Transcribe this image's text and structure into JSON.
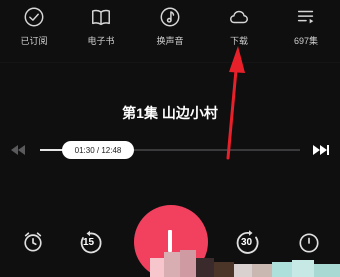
{
  "top_actions": [
    {
      "label": "已订阅",
      "icon": "check-circle-icon"
    },
    {
      "label": "电子书",
      "icon": "book-icon"
    },
    {
      "label": "换声音",
      "icon": "voice-icon"
    },
    {
      "label": "下载",
      "icon": "cloud-download-icon"
    },
    {
      "label": "697集",
      "icon": "playlist-icon"
    }
  ],
  "episode": {
    "title": "第1集 山边小村"
  },
  "progress": {
    "time_text": "01:30 / 12:48",
    "fraction": 0.117
  },
  "controls": {
    "rewind_label": "15",
    "forward_label": "30"
  },
  "colors": {
    "background": "#0f0f10",
    "play_button": "#f2415f",
    "annotation_arrow": "#e8202a"
  }
}
